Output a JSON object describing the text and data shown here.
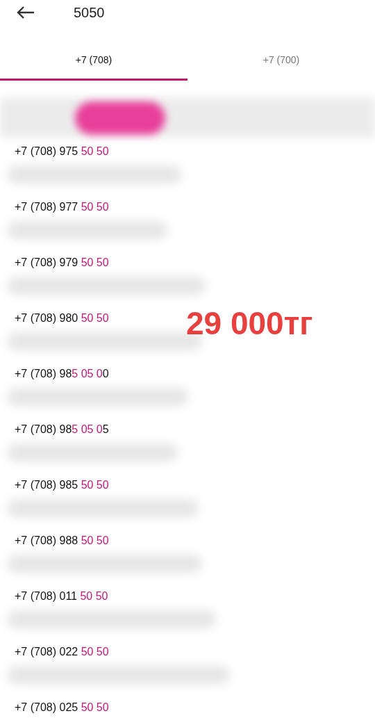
{
  "header": {
    "title": "5050"
  },
  "tabs": [
    {
      "label": "+7 (708)",
      "selected": true
    },
    {
      "label": "+7 (700)",
      "selected": false
    }
  ],
  "numbers": [
    {
      "plain": "+7 (708) 975 ",
      "match": "50 50"
    },
    {
      "plain": "+7 (708) 977 ",
      "match": "50 50"
    },
    {
      "plain": "+7 (708) 979 ",
      "match": "50 50"
    },
    {
      "plain": "+7 (708) 980 ",
      "match": "50 50"
    },
    {
      "plain": "+7 (708) 98",
      "match": "5 05 0",
      "rest": "0"
    },
    {
      "plain": "+7 (708) 98",
      "match": "5 05 0",
      "rest": "5"
    },
    {
      "plain": "+7 (708) 985 ",
      "match": "50 50"
    },
    {
      "plain": "+7 (708) 988 ",
      "match": "50 50"
    },
    {
      "plain": "+7 (708) 011 ",
      "match": "50 50"
    },
    {
      "plain": "+7 (708) 022 ",
      "match": "50 50"
    },
    {
      "plain": "+7 (708) 025 ",
      "match": "50 50"
    }
  ],
  "price": "29 000тг"
}
